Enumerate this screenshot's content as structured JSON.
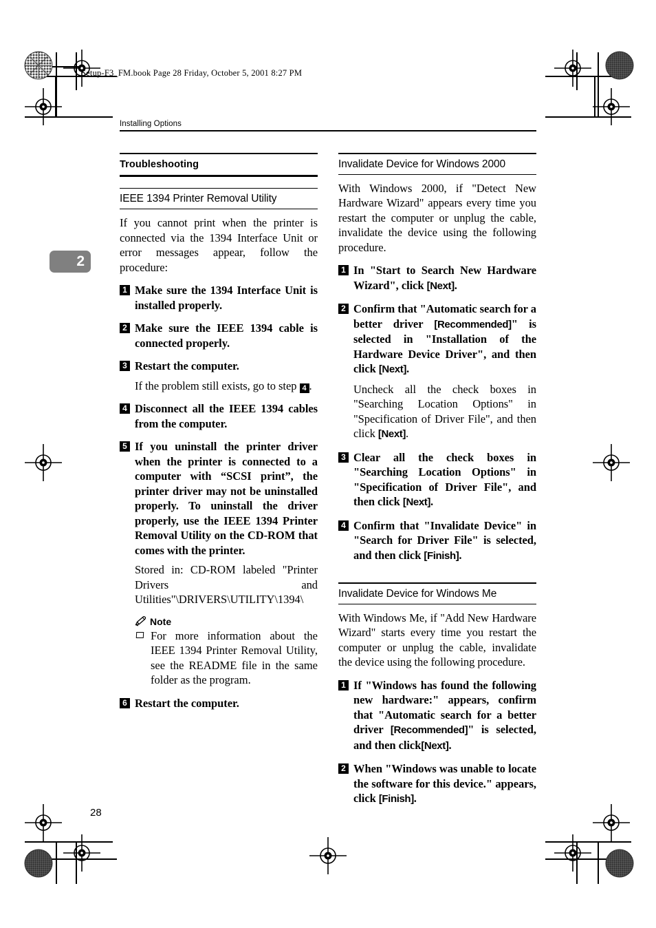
{
  "prepress": {
    "file_line": "Setup-F3_FM.book  Page 28  Friday, October 5, 2001  8:27 PM"
  },
  "running_header": {
    "title": "Installing Options"
  },
  "chapter_tab": {
    "number": "2",
    "color": "#808080"
  },
  "page_number": "28",
  "left_column": {
    "section_heading": "Troubleshooting",
    "subsection_heading": "IEEE 1394 Printer Removal Utility",
    "intro": "If you cannot print when the printer is connected via the 1394 Interface Unit or error messages appear, follow the procedure:",
    "steps": [
      {
        "num": "1",
        "text": "Make sure the 1394 Interface Unit is installed properly."
      },
      {
        "num": "2",
        "text": "Make sure the IEEE 1394 cable is connected properly."
      },
      {
        "num": "3",
        "text": "Restart the computer.",
        "sub_before": "If the problem still exists, go to step ",
        "sub_inline_num": "4",
        "sub_after": "."
      },
      {
        "num": "4",
        "text": "Disconnect all the IEEE 1394 cables from the computer."
      },
      {
        "num": "5",
        "text": "If you uninstall the printer driver when the printer is connected to a computer with “SCSI print”, the printer driver may not be uninstalled properly. To uninstall the driver properly, use the IEEE 1394 Printer Removal Utility on the CD-ROM that comes with the printer.",
        "sub": "Stored in: CD-ROM labeled \"Printer Drivers and Utilities\"\\DRIVERS\\UTILITY\\1394\\"
      },
      {
        "num": "6",
        "text": "Restart the computer."
      }
    ],
    "note": {
      "icon": "pencil-icon",
      "label": "Note",
      "items": [
        "For more information about the IEEE 1394 Printer Removal Utility, see the README file in the same folder as the program."
      ]
    }
  },
  "right_column": {
    "section_win2000": {
      "heading": "Invalidate Device for Windows 2000",
      "intro": "With Windows 2000, if \"Detect New Hardware Wizard\" appears every time you restart the computer or unplug the cable, invalidate the device using the following procedure.",
      "steps": [
        {
          "num": "1",
          "parts": [
            {
              "t": "In \"Start to Search New Hardware Wizard\", click ",
              "k": false
            },
            {
              "t": "[Next]",
              "k": true
            },
            {
              "t": ".",
              "k": false
            }
          ]
        },
        {
          "num": "2",
          "parts": [
            {
              "t": "Confirm that \"Automatic search for a better driver ",
              "k": false
            },
            {
              "t": "[Recommended]",
              "k": true
            },
            {
              "t": "\" is selected in \"Installation of the Hardware Device Driver\", and then click ",
              "k": false
            },
            {
              "t": "[Next]",
              "k": true
            },
            {
              "t": ".",
              "k": false
            }
          ],
          "sub_parts": [
            {
              "t": "Uncheck all the check boxes in \"Searching Location Options\" in \"Specification of Driver File\", and then click ",
              "k": false
            },
            {
              "t": "[Next]",
              "k": true
            },
            {
              "t": ".",
              "k": false
            }
          ]
        },
        {
          "num": "3",
          "parts": [
            {
              "t": "Clear all the check boxes in \"Searching Location Options\" in \"Specification of Driver File\", and then click ",
              "k": false
            },
            {
              "t": "[Next]",
              "k": true
            },
            {
              "t": ".",
              "k": false
            }
          ]
        },
        {
          "num": "4",
          "parts": [
            {
              "t": "Confirm that \"Invalidate Device\" in \"Search for Driver File\" is selected, and then click ",
              "k": false
            },
            {
              "t": "[Finish]",
              "k": true
            },
            {
              "t": ".",
              "k": false
            }
          ]
        }
      ]
    },
    "section_winme": {
      "heading": "Invalidate Device for Windows Me",
      "intro": "With Windows Me, if \"Add New Hardware Wizard\" starts every time you restart the computer or unplug the cable, invalidate the device using the following procedure.",
      "steps": [
        {
          "num": "1",
          "parts": [
            {
              "t": "If \"Windows has found the following new hardware:\" appears, confirm that \"Automatic search for a better driver ",
              "k": false
            },
            {
              "t": "[Recommended]",
              "k": true
            },
            {
              "t": "\" is selected, and then click",
              "k": false
            },
            {
              "t": "[Next]",
              "k": true
            },
            {
              "t": ".",
              "k": false
            }
          ]
        },
        {
          "num": "2",
          "parts": [
            {
              "t": "When \"Windows was unable to locate the software for this device.\" appears, click ",
              "k": false
            },
            {
              "t": "[Finish]",
              "k": true
            },
            {
              "t": ".",
              "k": false
            }
          ]
        }
      ]
    }
  }
}
